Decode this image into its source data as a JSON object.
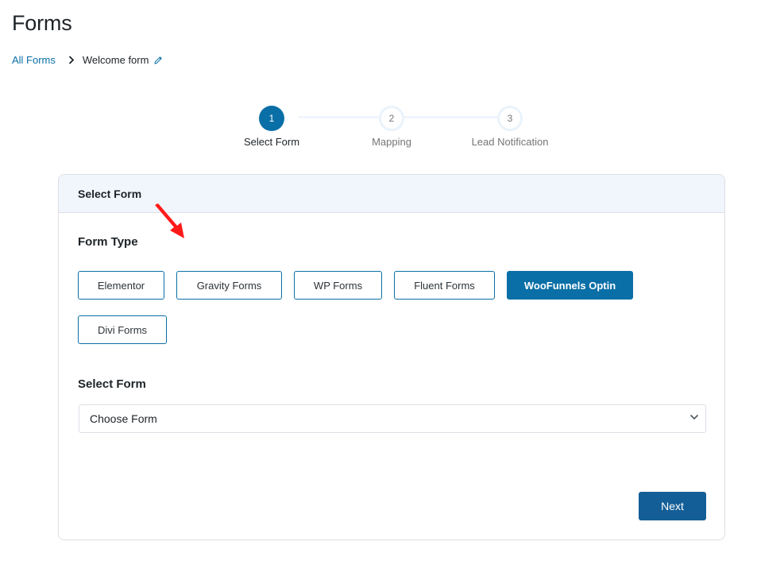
{
  "header": {
    "title": "Forms"
  },
  "breadcrumb": {
    "parent": "All Forms",
    "current": "Welcome form",
    "separator_icon": "chevron-right-icon",
    "edit_icon": "pencil-icon"
  },
  "stepper": {
    "steps": [
      {
        "number": "1",
        "label": "Select Form",
        "active": true
      },
      {
        "number": "2",
        "label": "Mapping",
        "active": false
      },
      {
        "number": "3",
        "label": "Lead Notification",
        "active": false
      }
    ]
  },
  "card": {
    "header_title": "Select Form",
    "form_type_label": "Form Type",
    "form_types": [
      {
        "label": "Elementor",
        "selected": false
      },
      {
        "label": "Gravity Forms",
        "selected": false
      },
      {
        "label": "WP Forms",
        "selected": false
      },
      {
        "label": "Fluent Forms",
        "selected": false
      },
      {
        "label": "WooFunnels Optin",
        "selected": true
      },
      {
        "label": "Divi Forms",
        "selected": false
      }
    ],
    "select_form_label": "Select Form",
    "select_form_value": "Choose Form",
    "next_label": "Next"
  },
  "colors": {
    "accent": "#0a6fa6",
    "primary_button": "#135e96",
    "header_bg": "#f0f6fc",
    "annotation_arrow": "#ff1a1a"
  }
}
